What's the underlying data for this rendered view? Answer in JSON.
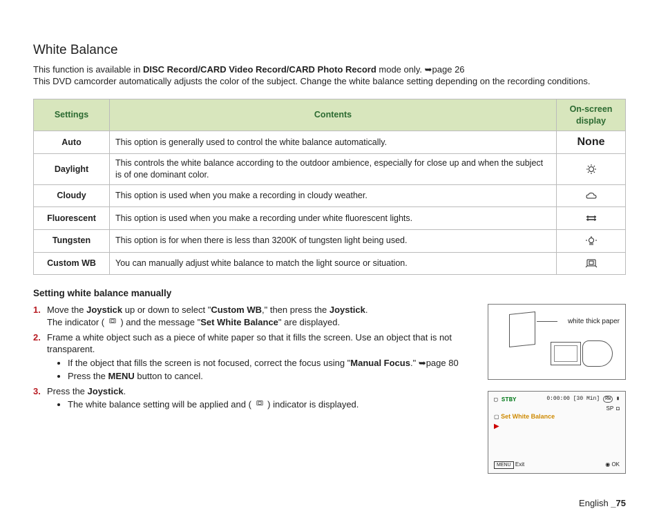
{
  "title": "White Balance",
  "intro": {
    "line1_a": "This function is available in ",
    "line1_b": "DISC Record/CARD Video Record/CARD Photo Record",
    "line1_c": " mode only. ",
    "page_ref": "➥page 26",
    "line2": "This DVD camcorder automatically adjusts the color of the subject. Change the white balance setting depending on the recording conditions."
  },
  "table": {
    "headers": {
      "settings": "Settings",
      "contents": "Contents",
      "display": "On-screen display"
    },
    "rows": [
      {
        "label": "Auto",
        "desc": "This option is generally used to control the white balance automatically.",
        "icon": "none",
        "icon_text": "None"
      },
      {
        "label": "Daylight",
        "desc": "This controls the white balance according to the outdoor ambience, especially for close up and when the subject is of one dominant color.",
        "icon": "sun"
      },
      {
        "label": "Cloudy",
        "desc": "This option is used when you make a recording in cloudy weather.",
        "icon": "cloud"
      },
      {
        "label": "Fluorescent",
        "desc": "This option is used when you make a recording under white fluorescent lights.",
        "icon": "fluorescent"
      },
      {
        "label": "Tungsten",
        "desc": "This option is for when there is less than 3200K of tungsten light being used.",
        "icon": "tungsten"
      },
      {
        "label": "Custom WB",
        "desc": "You can manually adjust white balance to match the light source or situation.",
        "icon": "custom"
      }
    ]
  },
  "manual_heading": "Setting white balance manually",
  "steps": {
    "s1_a": "Move the ",
    "s1_b": "Joystick",
    "s1_c": " up or down to select \"",
    "s1_d": "Custom WB",
    "s1_e": ",\" then press the ",
    "s1_f": "Joystick",
    "s1_g": ".",
    "s1_line2_a": "The indicator ( ",
    "s1_line2_b": " ) and the message \"",
    "s1_line2_c": "Set White Balance",
    "s1_line2_d": "\" are displayed.",
    "s2": "Frame a white object such as a piece of white paper so that it fills the screen. Use an object that is not transparent.",
    "s2_b1_a": "If the object that fills the screen is not focused, correct the focus using \"",
    "s2_b1_b": "Manual Focus",
    "s2_b1_c": ".\" ",
    "s2_b1_ref": "➥page 80",
    "s2_b2_a": "Press the ",
    "s2_b2_b": "MENU",
    "s2_b2_c": " button to cancel.",
    "s3_a": "Press the ",
    "s3_b": "Joystick",
    "s3_c": ".",
    "s3_b1_a": "The white balance setting will be applied and ( ",
    "s3_b1_b": " ) indicator is displayed."
  },
  "diagram": {
    "paper_label": "white thick paper"
  },
  "lcd": {
    "stby": "STBY",
    "time": "0:00:00 [30 Min]",
    "rw": "RW",
    "batt": "▮▮▮",
    "sp": "SP",
    "disc": "◘",
    "set_wb": "Set White Balance",
    "menu": "MENU",
    "exit": "Exit",
    "ok": "OK"
  },
  "footer": {
    "lang": "English ",
    "page": "_75"
  }
}
